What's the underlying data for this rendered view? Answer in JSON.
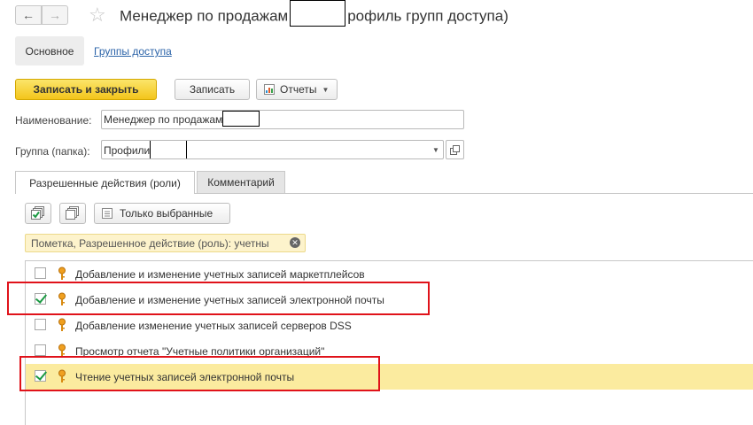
{
  "window": {
    "title_before": "Менеджер по продажам",
    "title_after": "рофиль групп доступа)"
  },
  "nav_tabs": {
    "main": "Основное",
    "groups": "Группы доступа"
  },
  "toolbar": {
    "save_close": "Записать и закрыть",
    "save": "Записать",
    "reports": "Отчеты"
  },
  "form": {
    "name_label": "Наименование:",
    "name_value": "Менеджер по продажам",
    "group_label": "Группа (папка):",
    "group_value": "Профили"
  },
  "tabs": {
    "allowed_actions": "Разрешенные действия (роли)",
    "comment": "Комментарий"
  },
  "list_toolbar": {
    "only_selected": "Только выбранные"
  },
  "filter": {
    "text": "Пометка, Разрешенное действие (роль): учетны"
  },
  "rows": [
    {
      "label": "Добавление и изменение учетных записей маркетплейсов",
      "checked": false
    },
    {
      "label": "Добавление и изменение учетных записей электронной почты",
      "checked": true
    },
    {
      "label": "Добавление изменение учетных записей серверов DSS",
      "checked": false
    },
    {
      "label": "Просмотр отчета \"Учетные политики организаций\"",
      "checked": false
    },
    {
      "label": "Чтение учетных записей электронной почты",
      "checked": true
    }
  ],
  "colors": {
    "primary_button": "#f3c51b",
    "selected_row": "#fbeb9f",
    "highlight_frame": "#e0121a",
    "link": "#2b63a8"
  }
}
